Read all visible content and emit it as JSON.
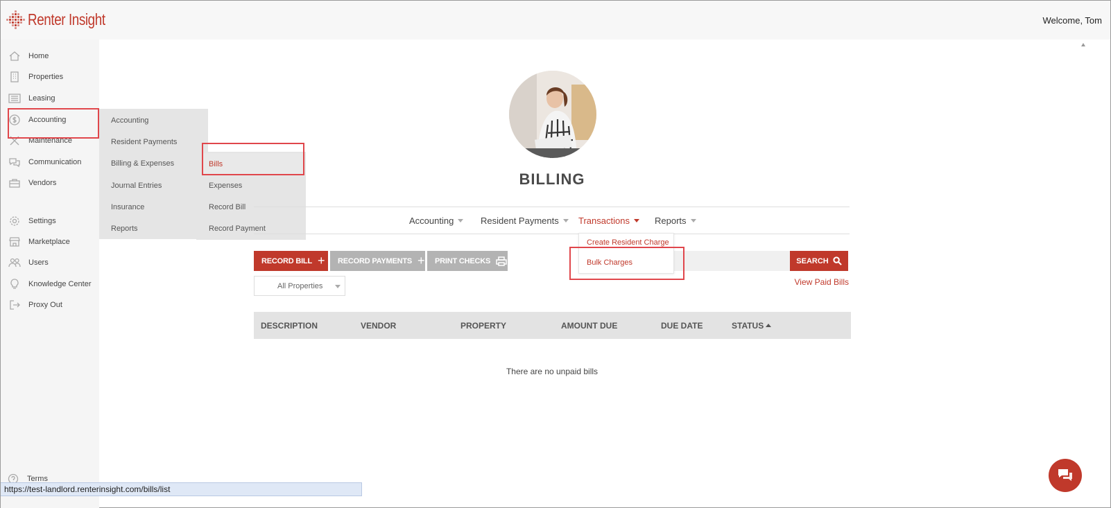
{
  "brand": {
    "name": "Renter Insight",
    "logo_icon": "diamond-dots-logo",
    "color": "#c0392b"
  },
  "header": {
    "welcome": "Welcome, Tom"
  },
  "sidebar": {
    "items": [
      {
        "label": "Home",
        "icon": "home-icon"
      },
      {
        "label": "Properties",
        "icon": "building-icon"
      },
      {
        "label": "Leasing",
        "icon": "list-icon"
      },
      {
        "label": "Accounting",
        "icon": "dollar-icon"
      },
      {
        "label": "Maintenance",
        "icon": "tools-icon"
      },
      {
        "label": "Communication",
        "icon": "chat-icon"
      },
      {
        "label": "Vendors",
        "icon": "briefcase-icon"
      },
      {
        "label": "Settings",
        "icon": "gear-icon"
      },
      {
        "label": "Marketplace",
        "icon": "store-icon"
      },
      {
        "label": "Users",
        "icon": "users-icon"
      },
      {
        "label": "Knowledge Center",
        "icon": "lightbulb-icon"
      },
      {
        "label": "Proxy Out",
        "icon": "exit-icon"
      }
    ],
    "terms": "Terms"
  },
  "accounting_flyout": {
    "items": [
      "Accounting",
      "Resident Payments",
      "Billing & Expenses",
      "Journal Entries",
      "Insurance",
      "Reports"
    ]
  },
  "billing_flyout": {
    "items": [
      "Bills",
      "Expenses",
      "Record Bill",
      "Record Payment"
    ]
  },
  "page": {
    "title": "BILLING",
    "subnav": [
      {
        "label": "Accounting"
      },
      {
        "label": "Resident Payments"
      },
      {
        "label": "Transactions",
        "active": true
      },
      {
        "label": "Reports"
      }
    ],
    "transactions_dropdown": [
      "Create Resident Charge",
      "Bulk Charges"
    ],
    "buttons": {
      "record_bill": "RECORD BILL",
      "record_payments": "RECORD PAYMENTS",
      "print_checks": "PRINT CHECKS",
      "search": "SEARCH"
    },
    "view_paid_bills": "View Paid Bills",
    "property_filter": "All Properties",
    "table": {
      "columns": [
        "DESCRIPTION",
        "VENDOR",
        "PROPERTY",
        "AMOUNT DUE",
        "DUE DATE",
        "STATUS"
      ],
      "sorted_by": "STATUS",
      "empty_message": "There are no unpaid bills"
    }
  },
  "status_url": "https://test-landlord.renterinsight.com/bills/list",
  "colors": {
    "accent": "#c0392b",
    "highlight_box": "#e0464b",
    "button_gray": "#b3b3b3"
  }
}
